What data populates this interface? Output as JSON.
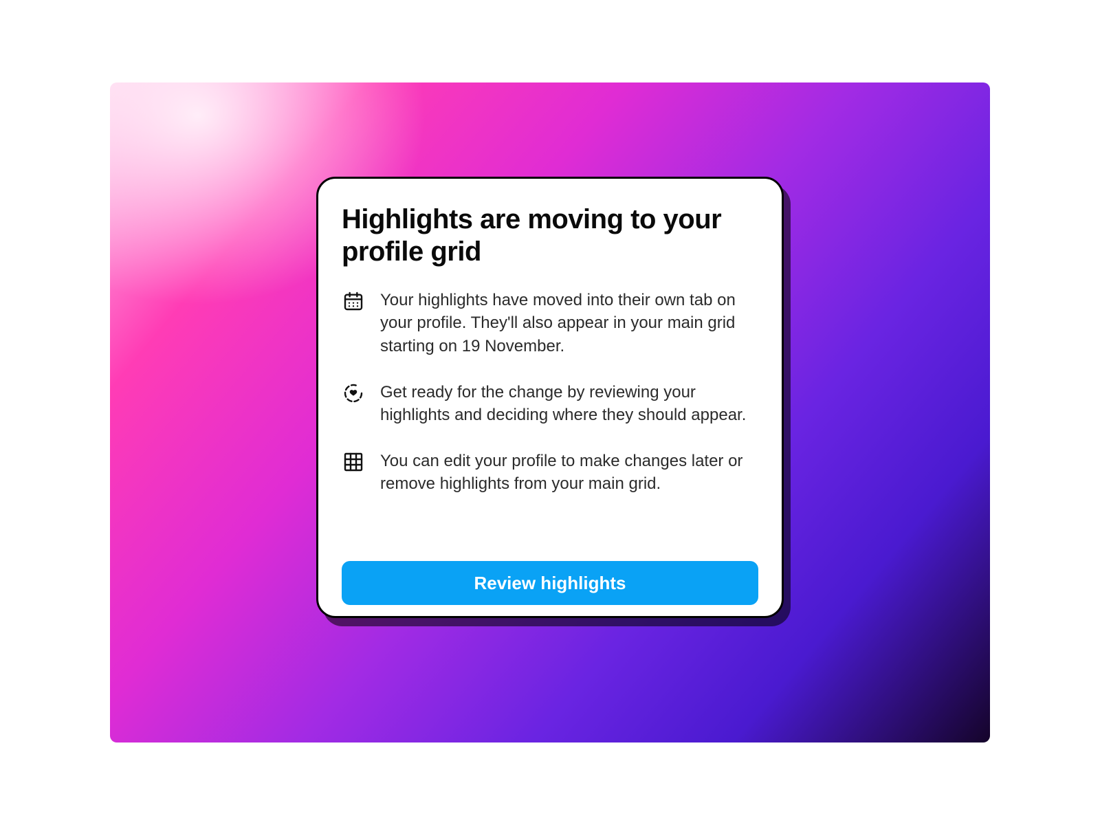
{
  "modal": {
    "title": "Highlights are moving to your profile grid",
    "items": [
      {
        "icon": "calendar-icon",
        "text": "Your highlights have moved into their own tab on your profile. They'll also appear in your main grid starting on 19 November."
      },
      {
        "icon": "heart-ring-icon",
        "text": "Get ready for the change by reviewing your highlights and deciding where they should appear."
      },
      {
        "icon": "grid-icon",
        "text": "You can edit your profile to make changes later or remove highlights from your main grid."
      }
    ],
    "cta_label": "Review highlights"
  },
  "colors": {
    "cta_background": "#0aa2f5",
    "text_primary": "#0a0a0a",
    "text_body": "#2b2b2b"
  }
}
